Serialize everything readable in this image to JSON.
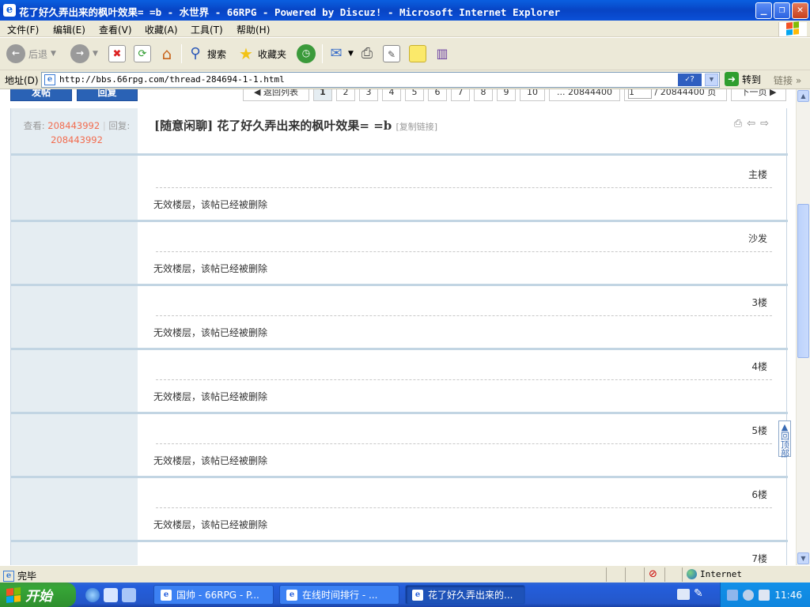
{
  "window": {
    "title": "花了好久弄出来的枫叶效果= =b - 水世界 - 66RPG - Powered by Discuz! - Microsoft Internet Explorer",
    "minimize": "_",
    "maximize": "❐",
    "close": "✕"
  },
  "menu": [
    "文件(F)",
    "编辑(E)",
    "查看(V)",
    "收藏(A)",
    "工具(T)",
    "帮助(H)"
  ],
  "toolbar": {
    "back": "后退",
    "search": "搜索",
    "favorites": "收藏夹"
  },
  "address": {
    "label": "地址(D)",
    "url": "http://bbs.66rpg.com/thread-284694-1-1.html",
    "go": "转到",
    "links": "链接"
  },
  "pagination": {
    "btn_post": "发帖",
    "btn_reply": "回复",
    "back_list": "返回列表",
    "pages": [
      "1",
      "2",
      "3",
      "4",
      "5",
      "6",
      "7",
      "8",
      "9",
      "10"
    ],
    "ellipsis": "... 20844400",
    "page_input": "1",
    "total": "/ 20844400 页",
    "next": "下一页"
  },
  "thread": {
    "views_label": "查看:",
    "views": "208443992",
    "replies_label": "回复:",
    "replies": "208443992",
    "title": "[随意闲聊] 花了好久弄出来的枫叶效果= =b",
    "copy_link": "[复制链接]"
  },
  "posts": [
    {
      "floor": "主楼",
      "message": "无效楼层，该帖已经被删除"
    },
    {
      "floor": "沙发",
      "message": "无效楼层，该帖已经被删除"
    },
    {
      "floor": "3楼",
      "message": "无效楼层，该帖已经被删除"
    },
    {
      "floor": "4楼",
      "message": "无效楼层，该帖已经被删除"
    },
    {
      "floor": "5楼",
      "message": "无效楼层，该帖已经被删除"
    },
    {
      "floor": "6楼",
      "message": "无效楼层，该帖已经被删除"
    },
    {
      "floor": "7楼",
      "message": ""
    }
  ],
  "back_to_top": "回顶部",
  "status": {
    "text": "完毕",
    "zone": "Internet"
  },
  "taskbar": {
    "start": "开始",
    "tasks": [
      "国帅 - 66RPG - P...",
      "在线时间排行 - ...",
      "花了好久弄出来的..."
    ],
    "clock": "11:46"
  }
}
